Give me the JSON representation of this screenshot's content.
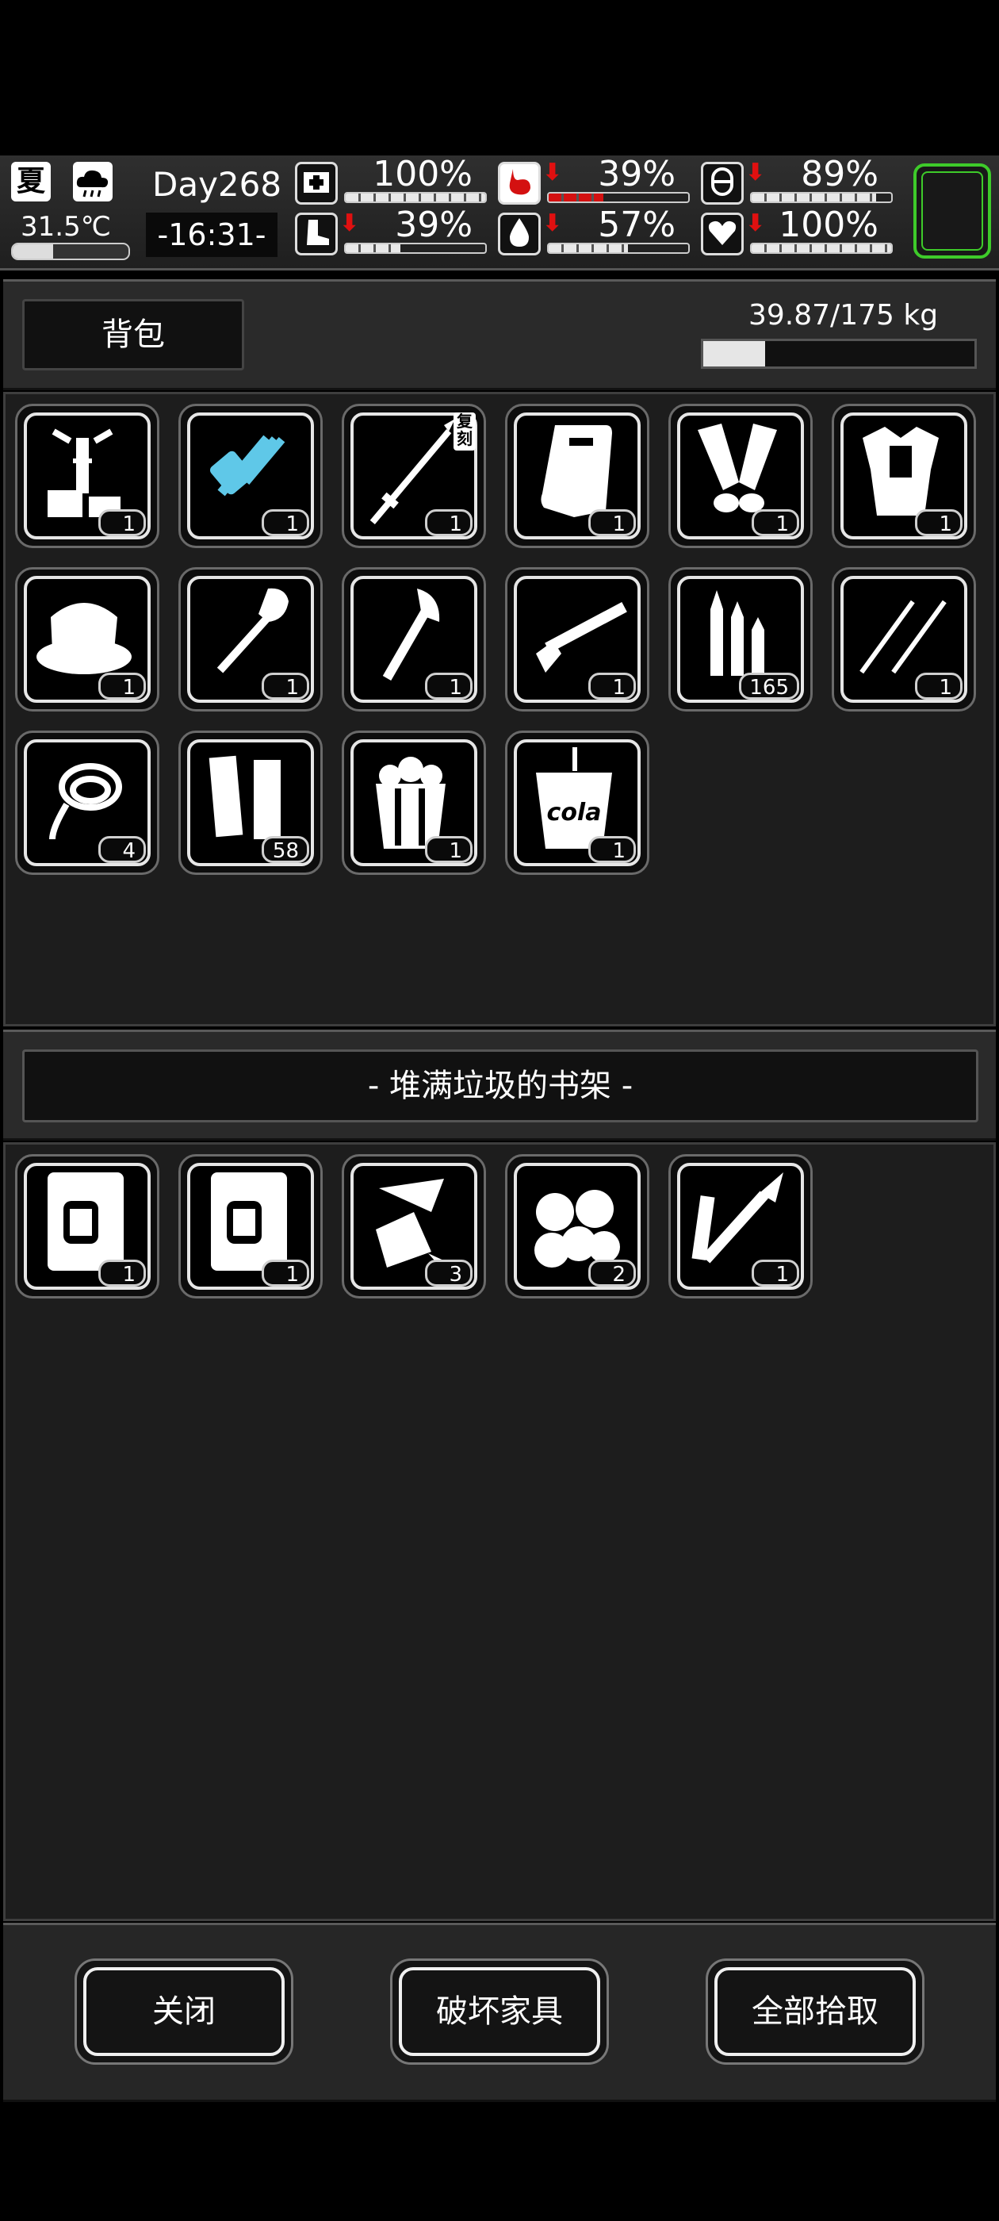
{
  "hud": {
    "season": "夏",
    "temperature": "31.5℃",
    "temperature_level": 0.35,
    "day": "Day268",
    "time": "-16:31-",
    "stats": [
      {
        "name": "health",
        "icon": "first-aid-icon",
        "value": "100%",
        "level": 1.0,
        "down": false
      },
      {
        "name": "hunger",
        "icon": "stomach-icon",
        "value": "39%",
        "level": 0.39,
        "down": true,
        "color": "#d41111"
      },
      {
        "name": "energy",
        "icon": "pill-icon",
        "value": "89%",
        "level": 0.89,
        "down": true
      },
      {
        "name": "stamina",
        "icon": "boot-icon",
        "value": "39%",
        "level": 0.39,
        "down": true
      },
      {
        "name": "thirst",
        "icon": "water-drop-icon",
        "value": "57%",
        "level": 0.57,
        "down": true
      },
      {
        "name": "mood",
        "icon": "heart-icon",
        "value": "100%",
        "level": 1.0,
        "down": true
      }
    ],
    "accent": "#3ecb2a"
  },
  "backpack": {
    "title": "背包",
    "weight": "39.87/175 kg",
    "weight_level": 0.228,
    "items": [
      {
        "icon": "crafting-stand-icon",
        "count": "1"
      },
      {
        "icon": "blue-minigun-icon",
        "count": "1"
      },
      {
        "icon": "spear-icon",
        "count": "1",
        "tag": "复刻"
      },
      {
        "icon": "riot-shield-icon",
        "count": "1"
      },
      {
        "icon": "leg-guards-icon",
        "count": "1"
      },
      {
        "icon": "fur-armor-icon",
        "count": "1"
      },
      {
        "icon": "fur-hat-icon",
        "count": "1"
      },
      {
        "icon": "shovel-icon",
        "count": "1"
      },
      {
        "icon": "axe-icon",
        "count": "1"
      },
      {
        "icon": "shotgun-icon",
        "count": "1"
      },
      {
        "icon": "bullets-icon",
        "count": "165"
      },
      {
        "icon": "lockpicks-icon",
        "count": "1"
      },
      {
        "icon": "rope-icon",
        "count": "4"
      },
      {
        "icon": "shotgun-shells-icon",
        "count": "58"
      },
      {
        "icon": "popcorn-icon",
        "count": "1"
      },
      {
        "icon": "cola-cup-icon",
        "count": "1",
        "label": "cola"
      }
    ]
  },
  "container": {
    "title": "- 堆满垃圾的书架 -",
    "items": [
      {
        "icon": "blueprint-scroll-icon",
        "count": "1"
      },
      {
        "icon": "blueprint-scroll-icon",
        "count": "1"
      },
      {
        "icon": "paper-scraps-icon",
        "count": "3"
      },
      {
        "icon": "cotton-balls-icon",
        "count": "2"
      },
      {
        "icon": "rocket-launcher-part-icon",
        "count": "1"
      }
    ]
  },
  "actions": {
    "close": "关闭",
    "destroy": "破坏家具",
    "take_all": "全部拾取"
  }
}
